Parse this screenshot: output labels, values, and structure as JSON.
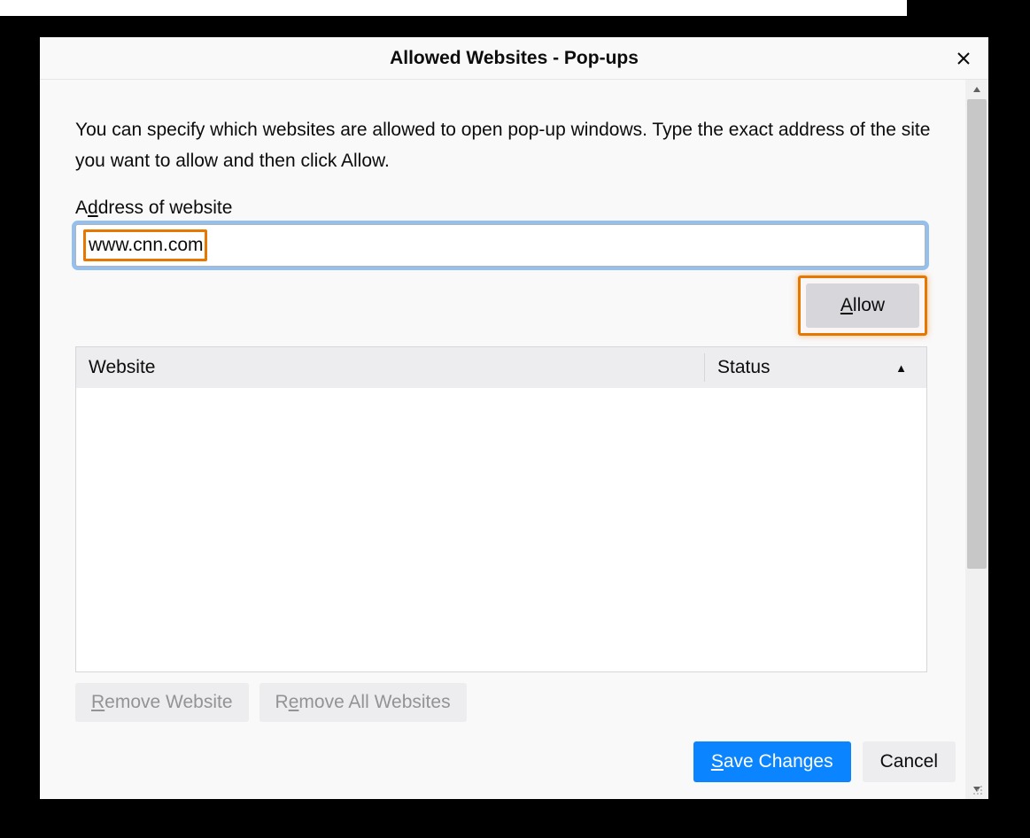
{
  "dialog": {
    "title": "Allowed Websites - Pop-ups",
    "intro": "You can specify which websites are allowed to open pop-up windows. Type the exact address of the site you want to allow and then click Allow.",
    "address_label_pre": "A",
    "address_label_u": "d",
    "address_label_post": "dress of website",
    "address_value": "www.cnn.com",
    "allow_label_u": "A",
    "allow_label_post": "llow",
    "table": {
      "col_website": "Website",
      "col_status": "Status",
      "rows": []
    },
    "remove_website_u": "R",
    "remove_website_post": "emove Website",
    "remove_all_pre": "R",
    "remove_all_u": "e",
    "remove_all_post": "move All Websites",
    "save_u": "S",
    "save_post": "ave Changes",
    "cancel": "Cancel"
  }
}
